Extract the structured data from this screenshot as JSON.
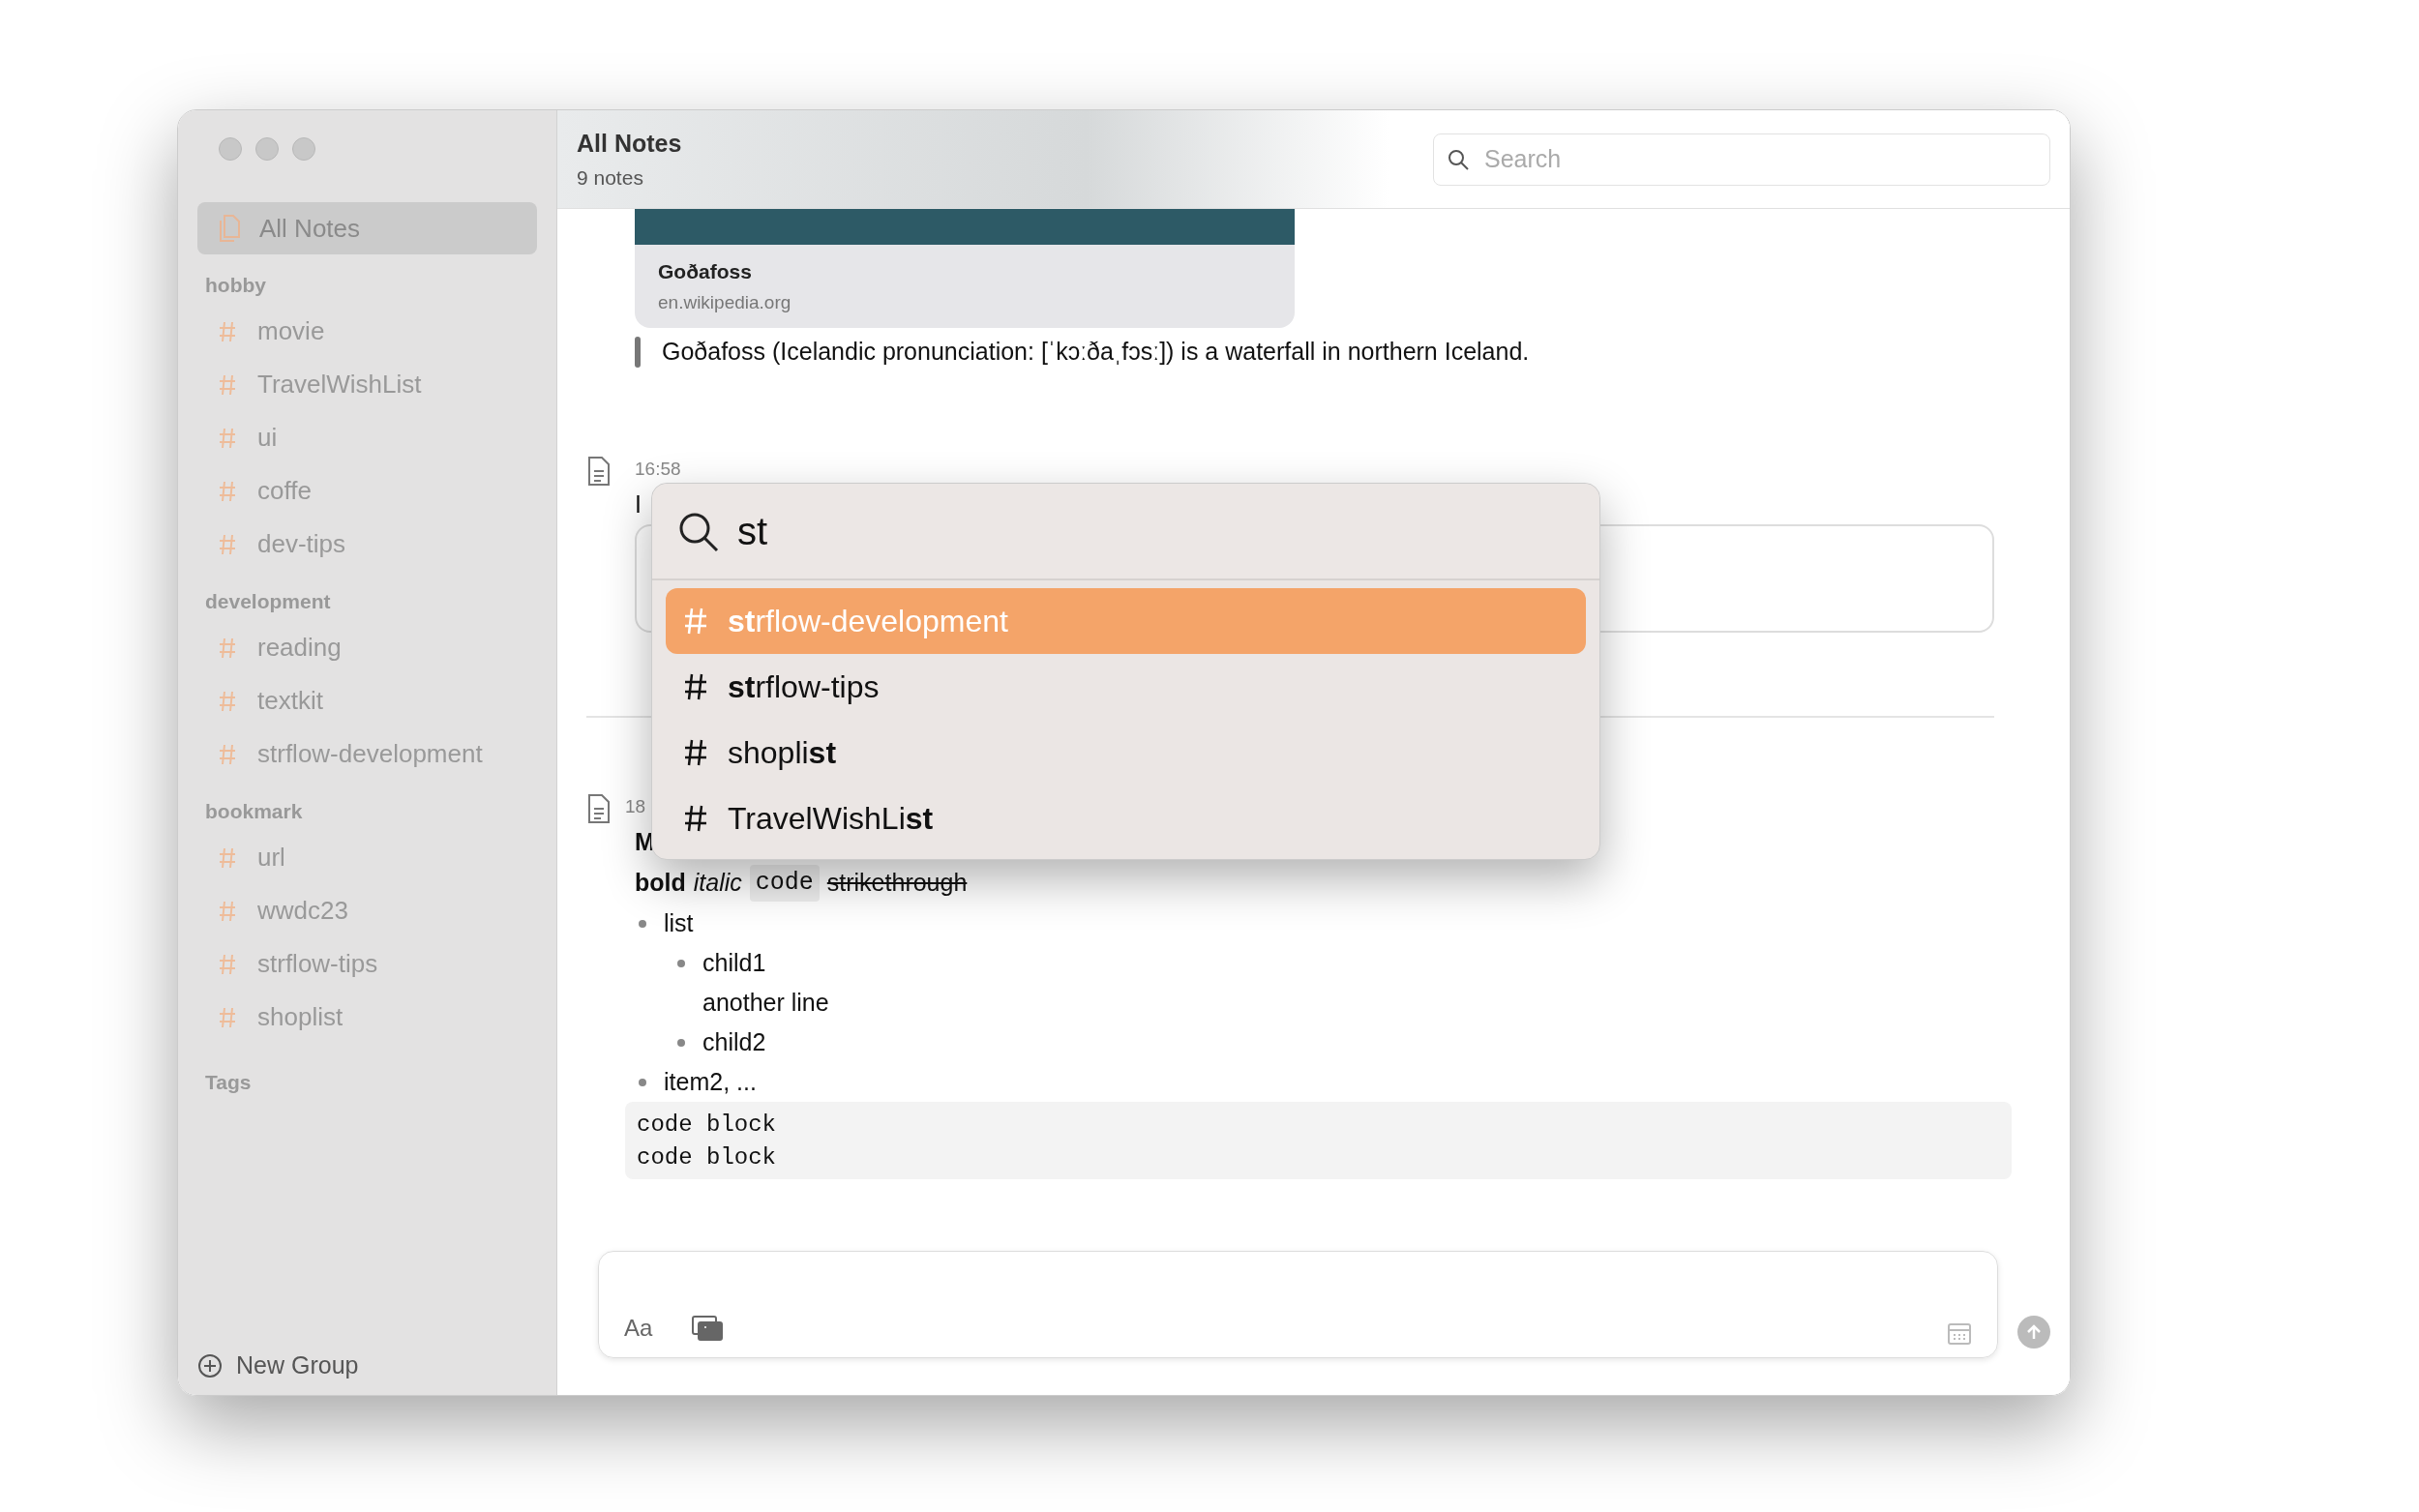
{
  "sidebar": {
    "all_notes": {
      "label": "All Notes",
      "selected": true
    },
    "groups": [
      {
        "name": "hobby",
        "tags": [
          {
            "label": "movie",
            "selected": false
          },
          {
            "label": "TravelWishList",
            "selected": false
          },
          {
            "label": "ui",
            "selected": false
          },
          {
            "label": "coffe",
            "selected": false
          },
          {
            "label": "dev-tips",
            "selected": false
          }
        ]
      },
      {
        "name": "development",
        "tags": [
          {
            "label": "reading",
            "selected": false
          },
          {
            "label": "textkit",
            "selected": false
          },
          {
            "label": "strflow-development",
            "selected": false
          }
        ]
      },
      {
        "name": "bookmark",
        "tags": [
          {
            "label": "url",
            "selected": false
          },
          {
            "label": "wwdc23",
            "selected": false
          },
          {
            "label": "strflow-tips",
            "selected": false
          },
          {
            "label": "shoplist",
            "selected": false
          }
        ]
      }
    ],
    "tags_heading": "Tags",
    "new_group": "New Group"
  },
  "header": {
    "title": "All Notes",
    "subtitle": "9 notes",
    "search": {
      "placeholder": "Search"
    }
  },
  "notes": [
    {
      "kind": "link",
      "link_title": "Goðafoss",
      "link_domain": "en.wikipedia.org",
      "quote": "Goðafoss (Icelandic pronunciation: [ˈkɔːðaˌfɔsː]) is a waterfall in northern Iceland."
    },
    {
      "kind": "partial",
      "time": "16:58",
      "text": "I"
    },
    {
      "kind": "markdown",
      "time": "18",
      "heading": "M",
      "format_samples": [
        {
          "kind": "bold",
          "text": "bold"
        },
        {
          "kind": "italic",
          "text": "italic"
        },
        {
          "kind": "code",
          "text": "code"
        },
        {
          "kind": "strike",
          "text": "strikethrough"
        }
      ],
      "list": [
        {
          "text": "list",
          "children": [
            {
              "text": "child1",
              "continuation": "another line"
            },
            {
              "text": "child2"
            }
          ]
        },
        {
          "text": "item2, ..."
        }
      ],
      "code_block": [
        "code block",
        "code block"
      ]
    }
  ],
  "tag_popup": {
    "query": "st",
    "results": [
      {
        "label": "**st**rflow-development",
        "selected": true
      },
      {
        "label": "**st**rflow-tips",
        "selected": false
      },
      {
        "label": "shopli**st**",
        "selected": false
      },
      {
        "label": "TravelWishLi**st**",
        "selected": false
      }
    ]
  },
  "composer": {
    "format_button": "Aa"
  }
}
